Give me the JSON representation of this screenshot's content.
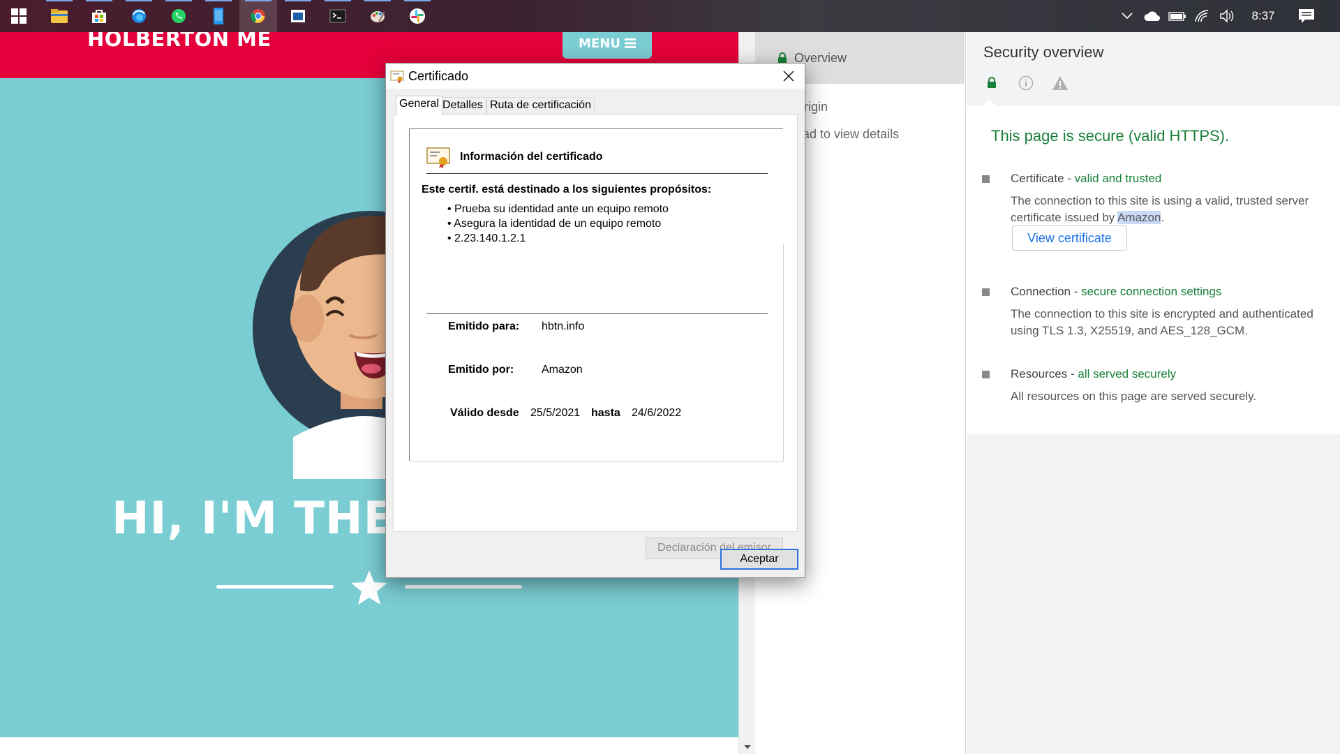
{
  "taskbar": {
    "apps": [
      "windows-start",
      "file-explorer",
      "microsoft-store",
      "edge",
      "whatsapp",
      "phone-app",
      "chrome",
      "app-window",
      "terminal",
      "paint",
      "slack"
    ],
    "clock": "8:37",
    "tray_icons": [
      "chevron-up-icon",
      "onedrive-icon",
      "battery-icon",
      "wifi-icon",
      "volume-icon",
      "notifications-icon"
    ]
  },
  "site": {
    "brand": "HOLBERTON ME",
    "menu_label": "MENU",
    "hero_heading": "HI, I'M THE C",
    "colors": {
      "header": "#e4003a",
      "background": "#7acdd3"
    }
  },
  "devtools_nav": {
    "overview_label": "Overview",
    "origin_label": "origin",
    "reload_hint": "ad to view details"
  },
  "security": {
    "title": "Security overview",
    "secure_message": "This page is secure (valid HTTPS).",
    "certificate": {
      "head": "Certificate",
      "status": "valid and trusted",
      "desc_prefix": "The connection to this site is using a valid, trusted server certificate issued by ",
      "issuer": "Amazon",
      "desc_suffix": ".",
      "button": "View certificate"
    },
    "connection": {
      "head": "Connection",
      "status": "secure connection settings",
      "desc": "The connection to this site is encrypted and authenticated using TLS 1.3, X25519, and AES_128_GCM."
    },
    "resources": {
      "head": "Resources",
      "status": "all served securely",
      "desc": "All resources on this page are served securely."
    },
    "separator": " - "
  },
  "dialog": {
    "title": "Certificado",
    "tabs": [
      "General",
      "Detalles",
      "Ruta de certificación"
    ],
    "heading": "Información del certificado",
    "purpose_title": "Este certif. está destinado a los siguientes propósitos:",
    "purposes": [
      "• Prueba su identidad ante un equipo remoto",
      "• Asegura la identidad de un equipo remoto",
      "• 2.23.140.1.2.1"
    ],
    "issued_to_label": "Emitido para:",
    "issued_to": "hbtn.info",
    "issued_by_label": "Emitido por:",
    "issued_by": "Amazon",
    "valid_from_label": "Válido desde",
    "valid_from": "25/5/2021",
    "valid_to_label": "hasta",
    "valid_to": "24/6/2022",
    "issuer_statement_button": "Declaración del emisor",
    "ok_button": "Aceptar"
  }
}
